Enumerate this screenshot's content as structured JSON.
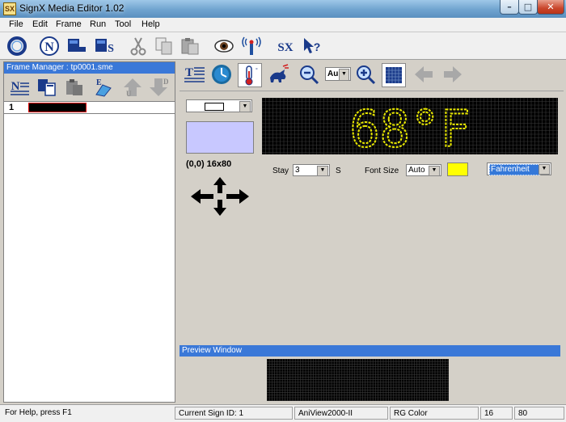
{
  "window": {
    "icon_text": "SX",
    "title": "SignX Media Editor 1.02",
    "min_glyph": "–",
    "max_glyph": "□",
    "close_glyph": "✕"
  },
  "menu": [
    "File",
    "Edit",
    "Frame",
    "Run",
    "Tool",
    "Help"
  ],
  "toolbar_icons": [
    "ring-icon",
    "new-n-icon",
    "frame-l-icon",
    "frame-s-icon",
    "cut-icon",
    "copy-icon",
    "paste-icon",
    "eye-icon",
    "broadcast-icon",
    "sx-icon",
    "help-arrow-icon"
  ],
  "frame_manager": {
    "title": "Frame Manager : tp0001.sme",
    "icons": [
      "new-frame-icon",
      "copy-frame-icon",
      "paste-frame-icon",
      "erase-icon",
      "move-up-icon",
      "move-down-icon"
    ],
    "frames": [
      {
        "number": "1"
      }
    ]
  },
  "editor_toolbar": {
    "icons": [
      "text-icon",
      "clock-icon",
      "thermometer-icon",
      "animation-icon",
      "zoom-out-icon",
      "zoom-in-icon",
      "grid-icon",
      "back-arrow-icon",
      "forward-arrow-icon"
    ],
    "zoom_value": "Au"
  },
  "editor": {
    "coords": "(0,0) 16x80",
    "led_text": "68°F",
    "stay_label": "Stay",
    "stay_value": "3",
    "stay_unit": "S",
    "font_size_label": "Font Size",
    "font_size_value": "Auto",
    "font_color": "#ffff00",
    "unit_value": "Fahrenheit"
  },
  "preview": {
    "title": "Preview Window"
  },
  "status": {
    "help": "For Help, press F1",
    "sign_id": "Current Sign ID: 1",
    "model": "AniView2000-II",
    "color_mode": "RG Color",
    "rows": "16",
    "cols": "80"
  },
  "colors": {
    "accent": "#3a78d8",
    "led_on": "#e8e800",
    "led_off": "#3a3a3a"
  }
}
